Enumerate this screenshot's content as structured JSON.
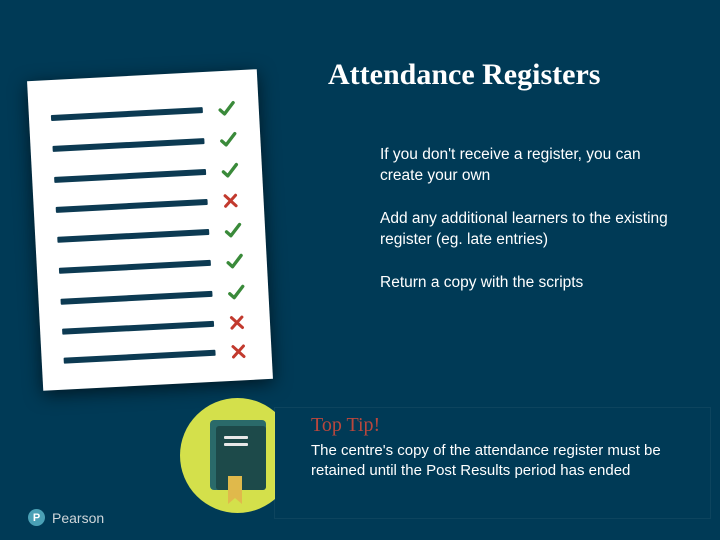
{
  "title": "Attendance Registers",
  "bullets": [
    "If you don't receive a register, you can create your own",
    "Add any additional learners to the existing register (eg. late entries)",
    "Return a copy with the scripts"
  ],
  "register": {
    "rows": [
      {
        "mark": "check"
      },
      {
        "mark": "check"
      },
      {
        "mark": "check"
      },
      {
        "mark": "cross"
      },
      {
        "mark": "check"
      },
      {
        "mark": "check"
      },
      {
        "mark": "check"
      },
      {
        "mark": "cross"
      },
      {
        "mark": "cross"
      }
    ]
  },
  "tip": {
    "title": "Top Tip!",
    "body": "The centre's copy of the attendance register must be retained until the Post Results period has ended"
  },
  "brand": {
    "letter": "P",
    "name": "Pearson"
  },
  "colors": {
    "check": "#3a8a3a",
    "cross": "#c23a2e"
  }
}
